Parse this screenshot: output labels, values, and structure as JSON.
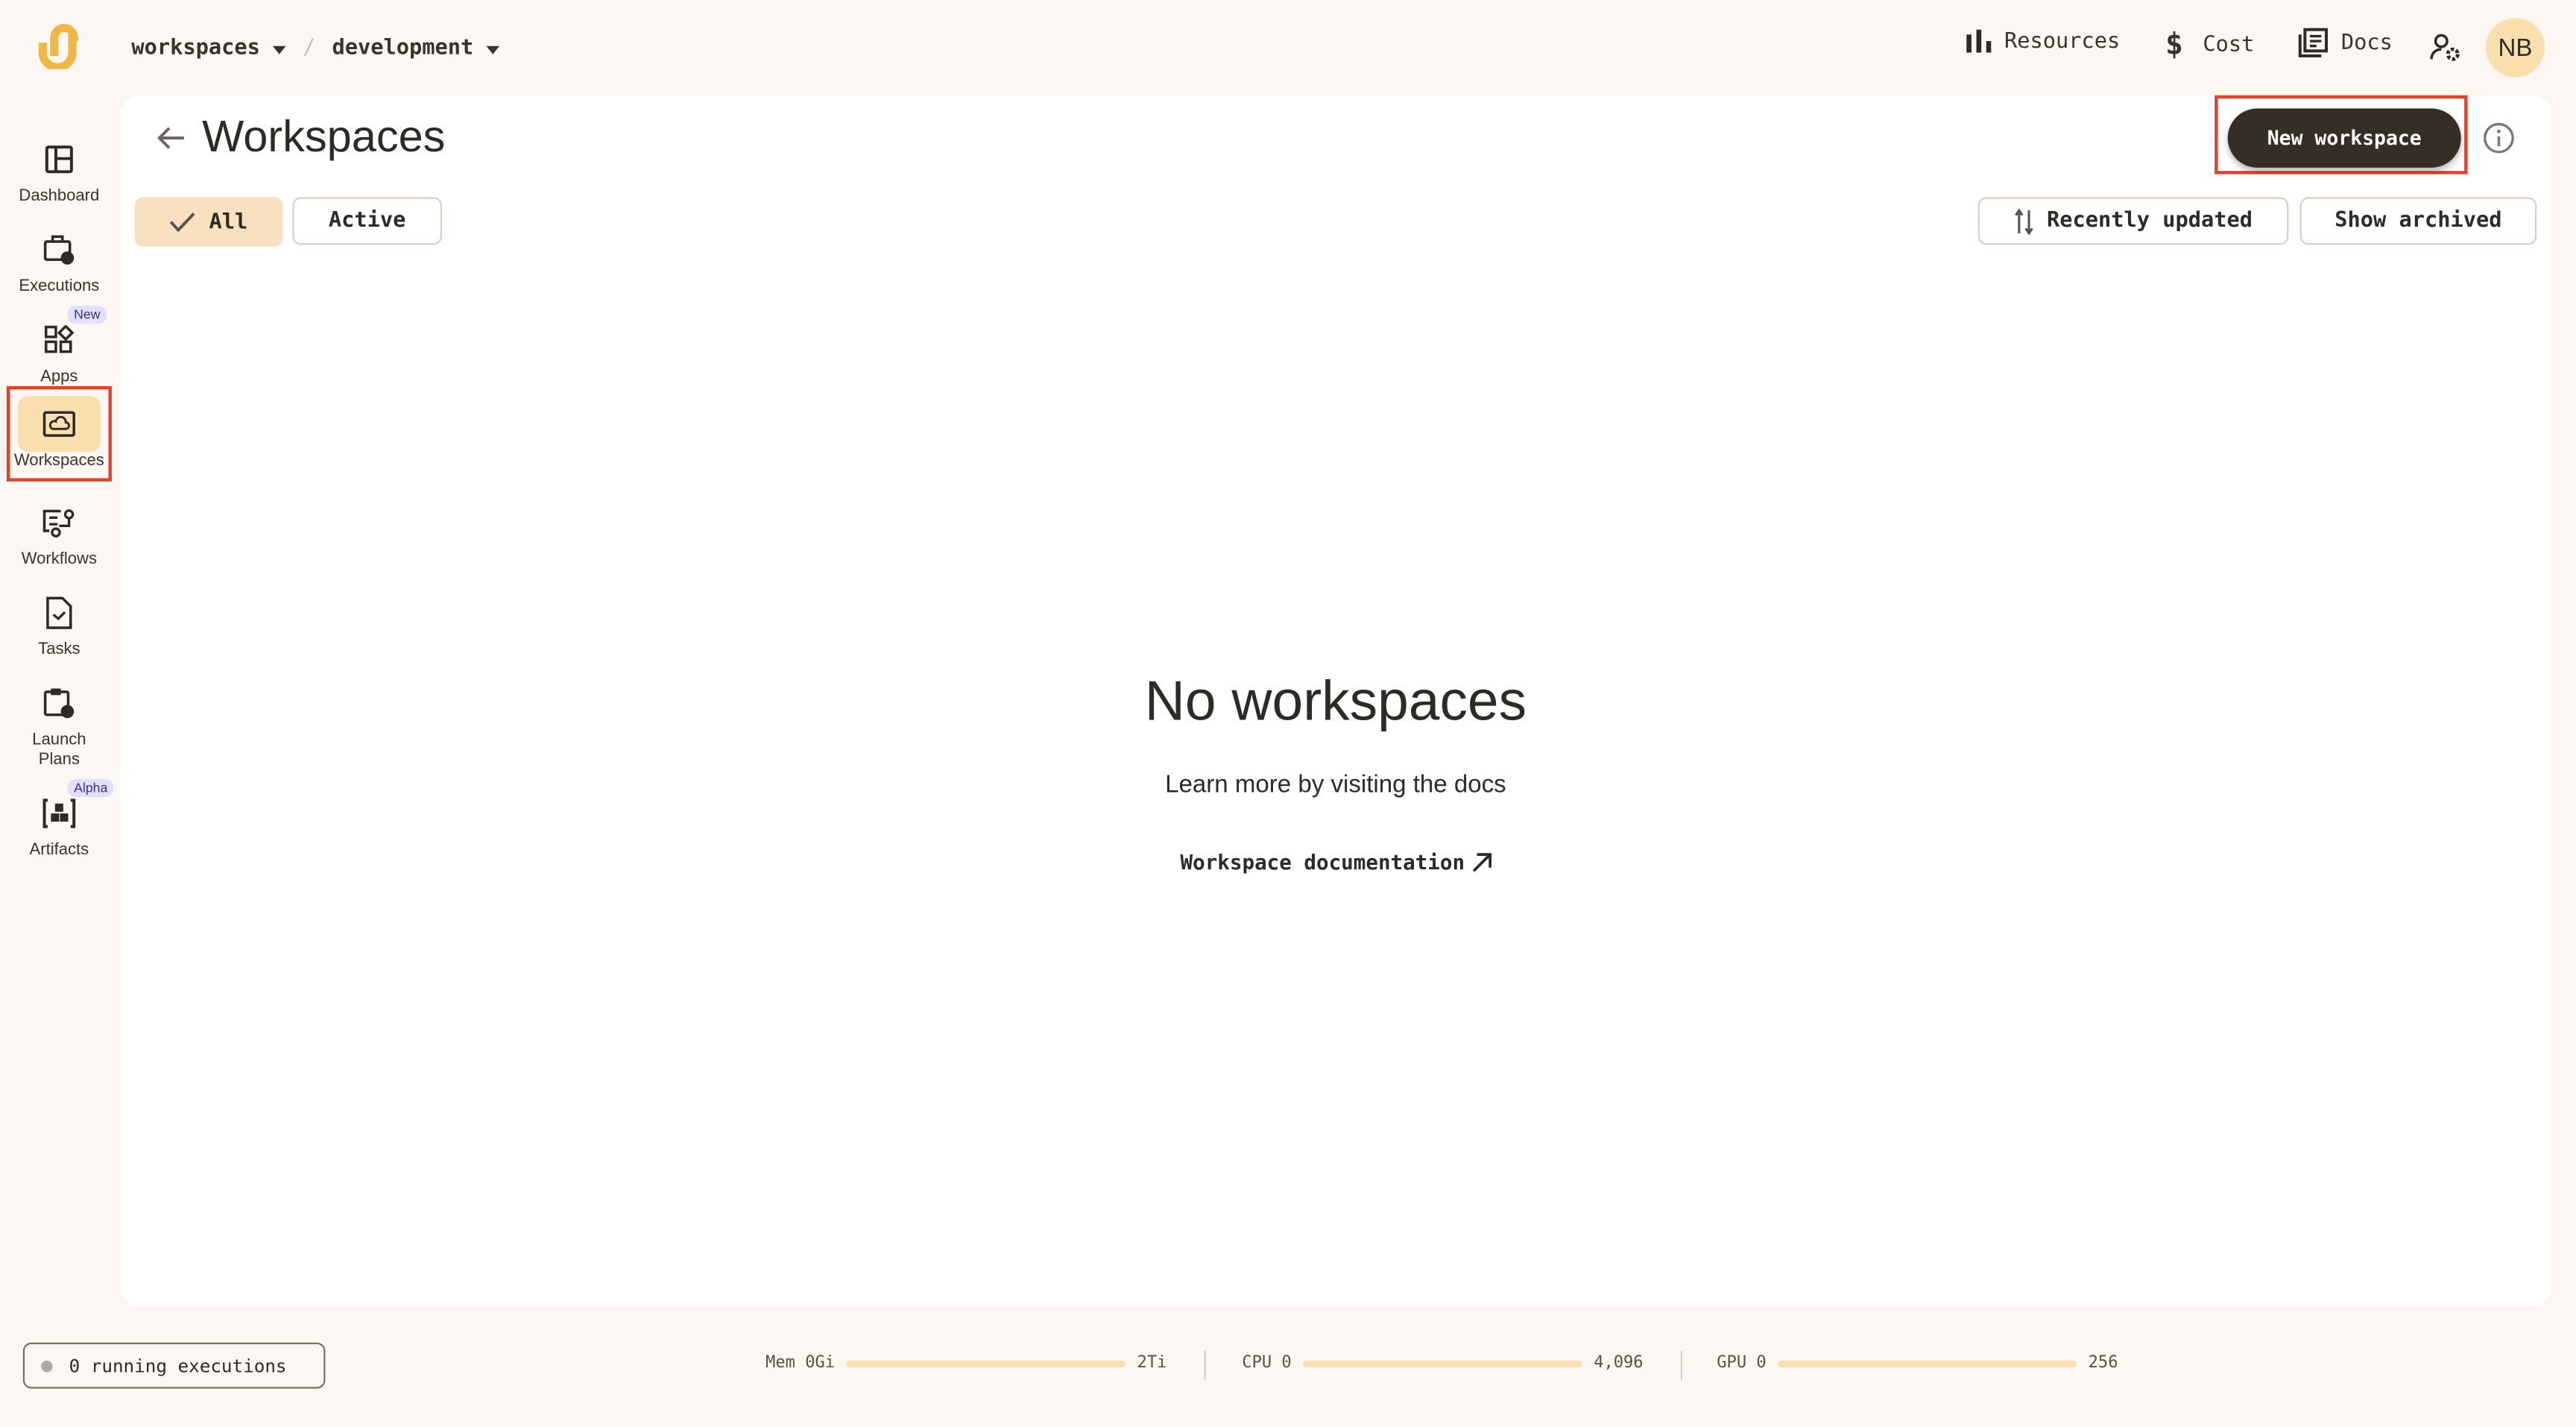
{
  "header": {
    "breadcrumb": [
      {
        "label": "workspaces"
      },
      {
        "label": "development"
      }
    ],
    "separator": "/",
    "nav": [
      {
        "label": "Resources",
        "icon": "bar-chart-icon"
      },
      {
        "label": "Cost",
        "icon": "dollar-icon"
      },
      {
        "label": "Docs",
        "icon": "docs-icon"
      }
    ],
    "user_settings_icon": "user-gear-icon",
    "avatar_initials": "NB",
    "brand_color": "#f0b742"
  },
  "sidebar": {
    "items": [
      {
        "label": "Dashboard",
        "icon": "dashboard-icon"
      },
      {
        "label": "Executions",
        "icon": "executions-icon"
      },
      {
        "label": "Apps",
        "icon": "apps-icon",
        "badge": "New"
      },
      {
        "label": "Workspaces",
        "icon": "workspace-cloud-icon",
        "active": true
      },
      {
        "label": "Workflows",
        "icon": "workflows-icon"
      },
      {
        "label": "Tasks",
        "icon": "tasks-icon"
      },
      {
        "label": "Launch Plans",
        "icon": "launch-plans-icon"
      },
      {
        "label": "Artifacts",
        "icon": "artifacts-icon",
        "badge": "Alpha"
      }
    ]
  },
  "main": {
    "title": "Workspaces",
    "new_button": "New workspace",
    "filters": [
      {
        "label": "All",
        "selected": true
      },
      {
        "label": "Active",
        "selected": false
      }
    ],
    "sort_label": "Recently updated",
    "archived_label": "Show archived",
    "empty": {
      "title": "No workspaces",
      "subtitle": "Learn more by visiting the docs",
      "link": "Workspace documentation"
    }
  },
  "footer": {
    "running": "0 running executions",
    "resources": [
      {
        "label": "Mem 0Gi",
        "max": "2Ti",
        "used_fraction": 0
      },
      {
        "label": "CPU 0",
        "max": "4,096",
        "used_fraction": 0
      },
      {
        "label": "GPU 0",
        "max": "256",
        "used_fraction": 0
      }
    ]
  }
}
